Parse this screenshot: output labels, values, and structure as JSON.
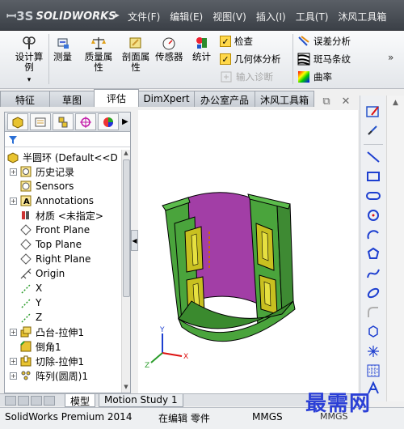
{
  "app": {
    "logo_text": "SOLIDWORKS",
    "logo_prefix": "3S"
  },
  "menu": [
    "文件(F)",
    "编辑(E)",
    "视图(V)",
    "插入(I)",
    "工具(T)",
    "沐风工具箱"
  ],
  "command_manager": {
    "design_study": "设计算例",
    "measure": "测量",
    "mass_props": "质量属性",
    "section_props": "剖面属性",
    "sensor": "传感器",
    "statistics": "统计",
    "check": "检查",
    "geometry_analysis": "几何体分析",
    "import_diag": "输入诊断",
    "deviation": "误差分析",
    "zebra": "斑马条纹",
    "curvature": "曲率",
    "more": "»"
  },
  "tabs": [
    "特征",
    "草图",
    "评估",
    "DimXpert",
    "办公室产品",
    "沐风工具箱"
  ],
  "active_tab": "评估",
  "tree": [
    {
      "label": "半圆环  (Default<<D",
      "icon": "part-icon",
      "expand": ""
    },
    {
      "label": "历史记录",
      "icon": "history-icon",
      "expand": "+"
    },
    {
      "label": "Sensors",
      "icon": "sensor-icon",
      "expand": ""
    },
    {
      "label": "Annotations",
      "icon": "annotation-icon",
      "expand": "+"
    },
    {
      "label": "材质 <未指定>",
      "icon": "material-icon",
      "expand": ""
    },
    {
      "label": "Front Plane",
      "icon": "plane-icon",
      "expand": ""
    },
    {
      "label": "Top Plane",
      "icon": "plane-icon",
      "expand": ""
    },
    {
      "label": "Right Plane",
      "icon": "plane-icon",
      "expand": ""
    },
    {
      "label": "Origin",
      "icon": "origin-icon",
      "expand": ""
    },
    {
      "label": "X",
      "icon": "axis-icon",
      "expand": ""
    },
    {
      "label": "Y",
      "icon": "axis-icon",
      "expand": ""
    },
    {
      "label": "Z",
      "icon": "axis-icon",
      "expand": ""
    },
    {
      "label": "凸台-拉伸1",
      "icon": "boss-extrude-icon",
      "expand": "+"
    },
    {
      "label": "倒角1",
      "icon": "chamfer-icon",
      "expand": ""
    },
    {
      "label": "切除-拉伸1",
      "icon": "cut-extrude-icon",
      "expand": "+"
    },
    {
      "label": "阵列(圆周)1",
      "icon": "pattern-icon",
      "expand": "+"
    }
  ],
  "bottom_tabs": {
    "model": "模型",
    "motion": "Motion Study 1"
  },
  "status": {
    "product": "SolidWorks Premium 2014",
    "editing": "在编辑 零件",
    "units": "MMGS"
  },
  "watermark": "最需网",
  "triad": {
    "x": "X",
    "y": "Y",
    "z": "Z"
  },
  "colors": {
    "part_green": "#4aa43c",
    "inner_purple": "#a23ea6",
    "pocket_yellow": "#c8c020",
    "accent_blue": "#1d3fd0"
  }
}
